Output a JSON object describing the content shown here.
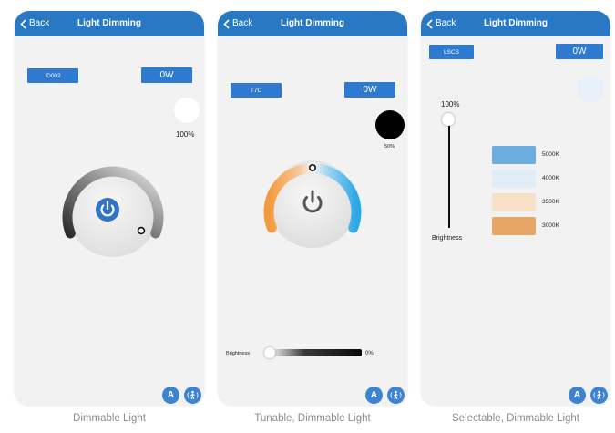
{
  "screens": [
    {
      "back": "Back",
      "title": "Light Dimming",
      "device_id": "ID002",
      "wattage": "0W",
      "brightness_percent": "100%",
      "caption": "Dimmable Light"
    },
    {
      "back": "Back",
      "title": "Light Dimming",
      "device_id": "T7C",
      "wattage": "0W",
      "color_percent": "50%",
      "brightness_label": "Brightness",
      "brightness_percent": "0%",
      "caption": "Tunable, Dimmable Light"
    },
    {
      "back": "Back",
      "title": "Light Dimming",
      "device_id": "LSCS",
      "wattage": "0W",
      "brightness_percent": "100%",
      "brightness_label": "Brightness",
      "color_temps": [
        {
          "label": "5000K",
          "color": "#6badde"
        },
        {
          "label": "4000K",
          "color": "#e1eef8"
        },
        {
          "label": "3500K",
          "color": "#f6e1c7"
        },
        {
          "label": "3000K",
          "color": "#e7a566"
        }
      ],
      "caption": "Selectable, Dimmable Light"
    }
  ],
  "fab_auto_text": "A",
  "icons": [
    "chevron-left-icon",
    "power-icon",
    "auto-mode-icon",
    "motion-sensor-icon"
  ],
  "colors": {
    "nav": "#2878c3",
    "button": "#2d7ad0",
    "power": "#2e74c8",
    "warm": "#f39a3a",
    "cool": "#2ba8e6"
  }
}
